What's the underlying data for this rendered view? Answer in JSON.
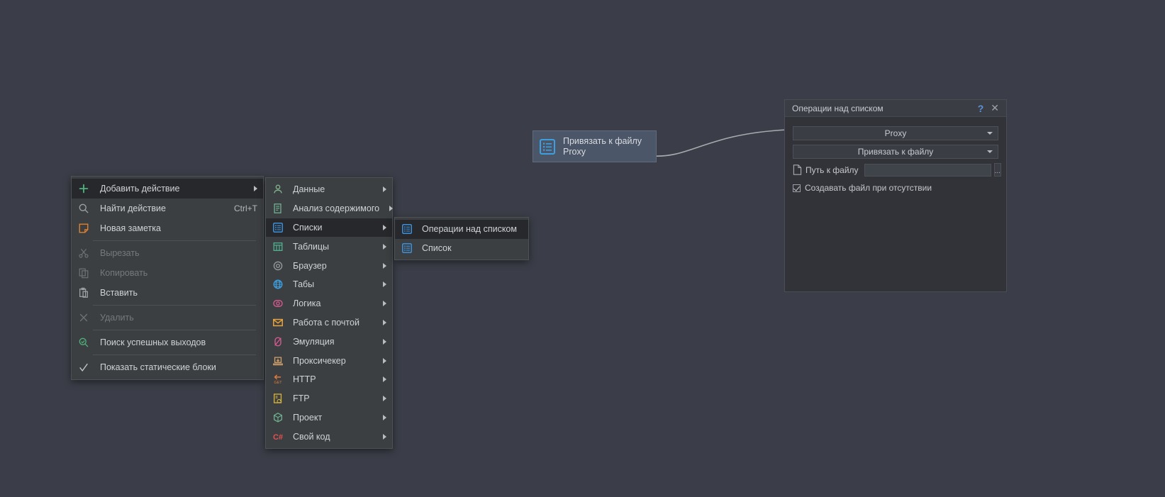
{
  "canvas": {
    "node": {
      "icon": "list-icon",
      "title": "Привязать к файлу",
      "subtitle": "Proxy"
    }
  },
  "context_menu": {
    "items": [
      {
        "label": "Добавить действие",
        "icon": "plus-icon",
        "accel": "",
        "submenu": true,
        "highlighted": true,
        "disabled": false
      },
      {
        "label": "Найти действие",
        "icon": "search-icon",
        "accel": "Ctrl+T",
        "submenu": false,
        "highlighted": false,
        "disabled": false
      },
      {
        "label": "Новая заметка",
        "icon": "note-icon",
        "accel": "",
        "submenu": false,
        "highlighted": false,
        "disabled": false
      },
      {
        "separator": true
      },
      {
        "label": "Вырезать",
        "icon": "scissors-icon",
        "accel": "",
        "submenu": false,
        "highlighted": false,
        "disabled": true
      },
      {
        "label": "Копировать",
        "icon": "copy-icon",
        "accel": "",
        "submenu": false,
        "highlighted": false,
        "disabled": true
      },
      {
        "label": "Вставить",
        "icon": "paste-icon",
        "accel": "",
        "submenu": false,
        "highlighted": false,
        "disabled": false
      },
      {
        "separator": true
      },
      {
        "label": "Удалить",
        "icon": "x-icon",
        "accel": "",
        "submenu": false,
        "highlighted": false,
        "disabled": true
      },
      {
        "separator": true
      },
      {
        "label": "Поиск успешных выходов",
        "icon": "search-check-icon",
        "accel": "",
        "submenu": false,
        "highlighted": false,
        "disabled": false
      },
      {
        "separator": true
      },
      {
        "label": "Показать статические блоки",
        "icon": "checkmark-icon",
        "accel": "",
        "submenu": false,
        "highlighted": false,
        "disabled": false
      }
    ]
  },
  "category_menu": {
    "items": [
      {
        "label": "Данные",
        "icon": "person-icon",
        "color": "#7fb08e",
        "highlighted": false
      },
      {
        "label": "Анализ содержимого",
        "icon": "document-analyze-icon",
        "color": "#6fae91",
        "highlighted": false
      },
      {
        "label": "Списки",
        "icon": "list-icon",
        "color": "#3d8fd8",
        "highlighted": true
      },
      {
        "label": "Таблицы",
        "icon": "table-icon",
        "color": "#4fae8e",
        "highlighted": false
      },
      {
        "label": "Браузер",
        "icon": "browser-gear-icon",
        "color": "#9aa0a6",
        "highlighted": false
      },
      {
        "label": "Табы",
        "icon": "globe-icon",
        "color": "#3d9fe0",
        "highlighted": false
      },
      {
        "label": "Логика",
        "icon": "logic-icon",
        "color": "#d2598f",
        "highlighted": false
      },
      {
        "label": "Работа с почтой",
        "icon": "mail-icon",
        "color": "#e8a33d",
        "highlighted": false
      },
      {
        "label": "Эмуляция",
        "icon": "mouse-icon",
        "color": "#d2598f",
        "highlighted": false
      },
      {
        "label": "Проксичекер",
        "icon": "proxy-icon",
        "color": "#d2a06a",
        "highlighted": false
      },
      {
        "label": "HTTP",
        "icon": "http-get-icon",
        "color": "#e07b3c",
        "highlighted": false
      },
      {
        "label": "FTP",
        "icon": "ftp-icon",
        "color": "#d4b33d",
        "highlighted": false
      },
      {
        "label": "Проект",
        "icon": "cube-icon",
        "color": "#6fae91",
        "highlighted": false
      },
      {
        "label": "Свой код",
        "icon": "csharp-icon",
        "color": "#e05252",
        "highlighted": false
      }
    ]
  },
  "lists_menu": {
    "items": [
      {
        "label": "Операции над списком",
        "icon": "list-icon",
        "highlighted": true
      },
      {
        "label": "Список",
        "icon": "list-icon",
        "highlighted": false
      }
    ]
  },
  "dialog": {
    "title": "Операции над списком",
    "help_label": "?",
    "close_label": "✕",
    "combo_variable": "Proxy",
    "combo_action": "Привязать к файлу",
    "path_label": "Путь к файлу",
    "path_value": "",
    "path_placeholder": "",
    "browse_label": "...",
    "checkbox_label": "Создавать файл при отсутствии"
  },
  "colors": {
    "background": "#3b3e48",
    "menu_bg": "#3c3f41",
    "menu_highlight": "#26282b",
    "dialog_bg": "#323339",
    "accent_blue": "#3d8fd8",
    "accent_green": "#4eb07a",
    "node_bg": "#4b5668"
  }
}
